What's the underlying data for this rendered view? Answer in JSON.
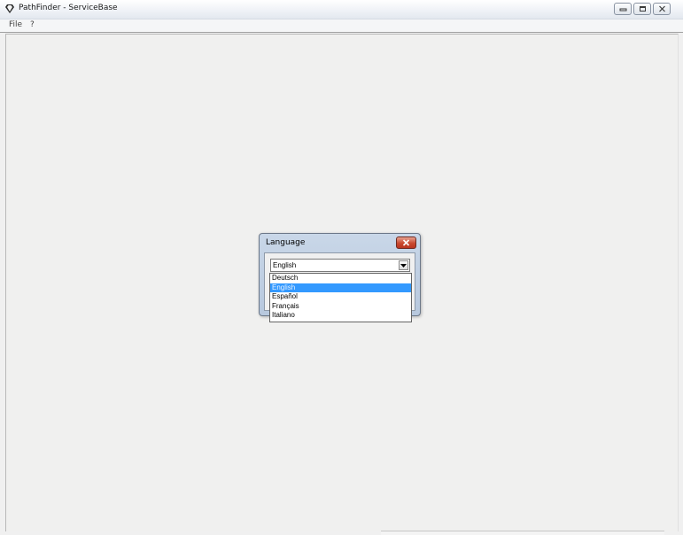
{
  "window": {
    "title": "PathFinder - ServiceBase",
    "icon": "diamond-icon"
  },
  "menu": {
    "items": [
      {
        "label": "File"
      },
      {
        "label": "?"
      }
    ]
  },
  "dialog": {
    "title": "Language",
    "combo": {
      "value": "English",
      "expanded": true
    },
    "options": [
      {
        "label": "Deutsch"
      },
      {
        "label": "English",
        "selected": true
      },
      {
        "label": "Español"
      },
      {
        "label": "Français"
      },
      {
        "label": "Italiano"
      }
    ]
  },
  "colors": {
    "selection": "#3399ff",
    "dialog_frame": "#b7c8de",
    "close_button": "#c9492f"
  }
}
